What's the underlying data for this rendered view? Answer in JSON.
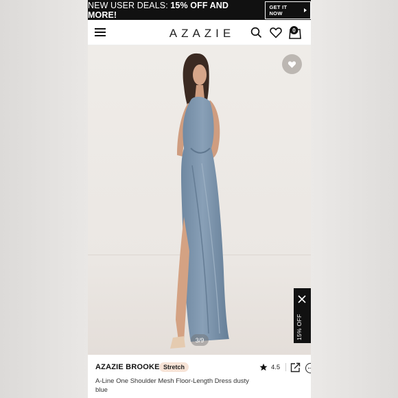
{
  "promo": {
    "text_prefix": "NEW USER DEALS: ",
    "text_highlight": "15% OFF AND MORE!",
    "cta_label": "GET IT NOW"
  },
  "header": {
    "logo": "AZAZIE",
    "cart_count": "0"
  },
  "gallery": {
    "counter": "3/9",
    "discount_tab": "15% OFF"
  },
  "product": {
    "brand": "AZAZIE BROOKE",
    "badge": "Stretch",
    "rating": "4.5",
    "name": "A-Line One Shoulder Mesh Floor-Length Dress dusty blue"
  },
  "icons": [
    "menu-icon",
    "search-icon",
    "heart-icon",
    "bag-icon",
    "favorite-icon",
    "close-icon",
    "star-icon",
    "share-icon",
    "more-icon"
  ],
  "colors": {
    "promo_bg": "#111111",
    "badge_bg": "#f7e3d6",
    "dress": "#7d95ad"
  }
}
